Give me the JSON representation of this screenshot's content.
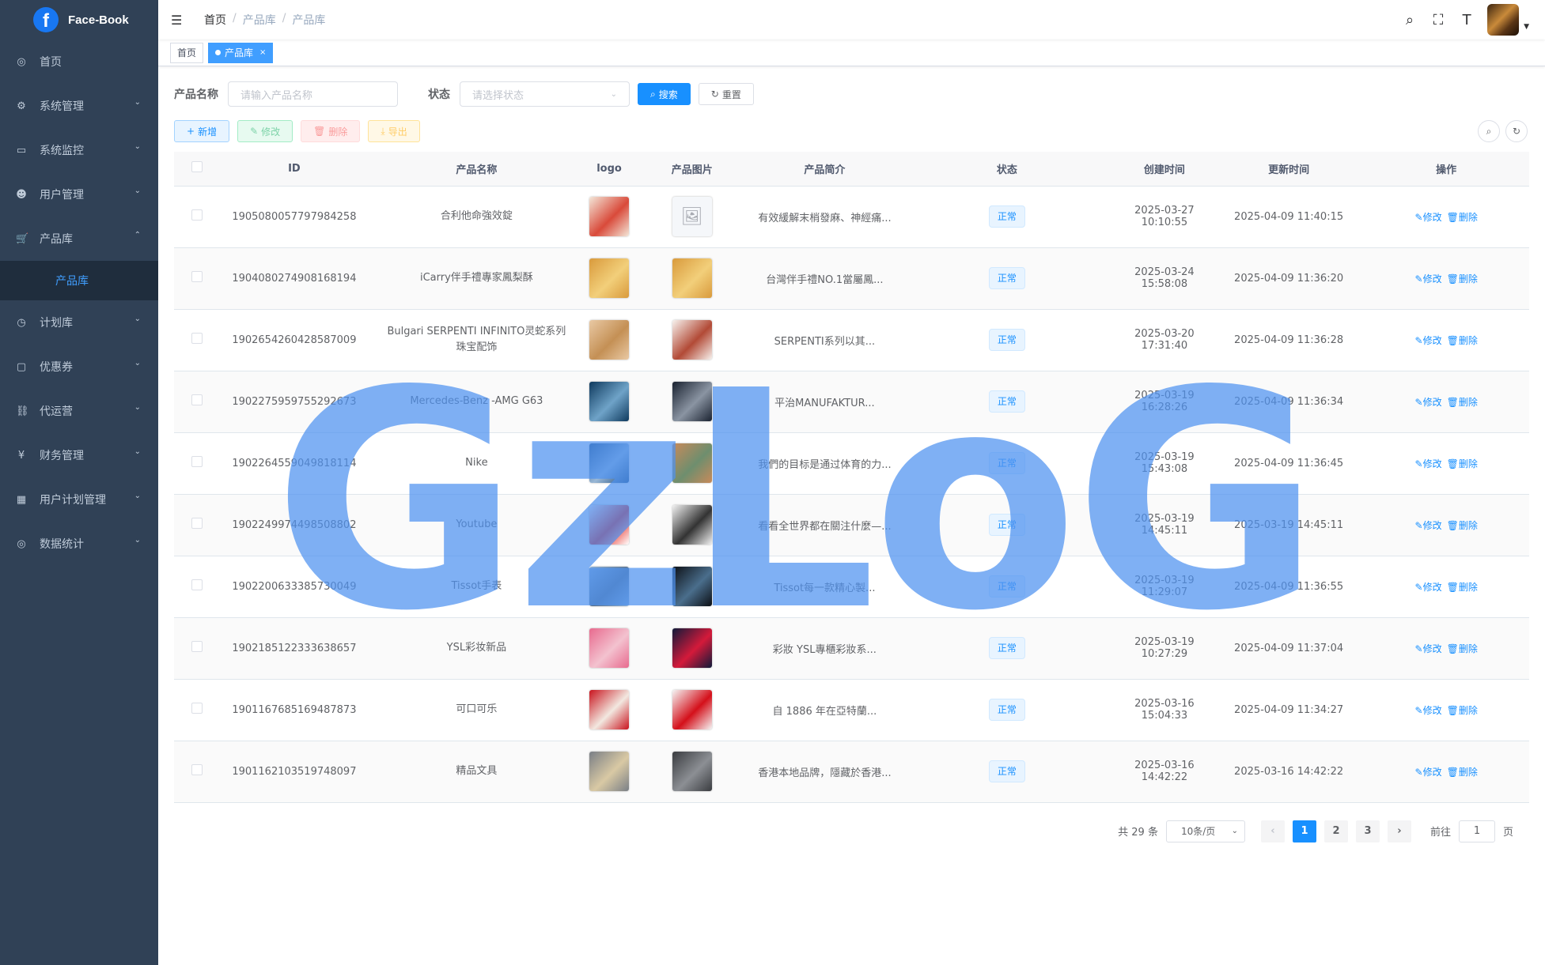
{
  "app": {
    "title": "Face-Book",
    "logo_letter": "f"
  },
  "sidebar": {
    "items": [
      {
        "label": "首页",
        "icon": "dashboard-icon",
        "glyph": "◎",
        "arrow": ""
      },
      {
        "label": "系统管理",
        "icon": "gear-icon",
        "glyph": "⚙",
        "arrow": "⌄"
      },
      {
        "label": "系统监控",
        "icon": "monitor-icon",
        "glyph": "▭",
        "arrow": "⌄"
      },
      {
        "label": "用户管理",
        "icon": "user-icon",
        "glyph": "☻",
        "arrow": "⌄"
      },
      {
        "label": "产品库",
        "icon": "cart-icon",
        "glyph": "🛒",
        "arrow": "⌃"
      },
      {
        "label": "计划库",
        "icon": "clock-icon",
        "glyph": "◷",
        "arrow": "⌄"
      },
      {
        "label": "优惠券",
        "icon": "coupon-icon",
        "glyph": "▢",
        "arrow": "⌄"
      },
      {
        "label": "代运营",
        "icon": "agent-icon",
        "glyph": "⛓",
        "arrow": "⌄"
      },
      {
        "label": "财务管理",
        "icon": "yen-icon",
        "glyph": "¥",
        "arrow": "⌄"
      },
      {
        "label": "用户计划管理",
        "icon": "grid-icon",
        "glyph": "▦",
        "arrow": "⌄"
      },
      {
        "label": "数据统计",
        "icon": "chart-icon",
        "glyph": "◎",
        "arrow": "⌄"
      }
    ],
    "active_sub": "产品库"
  },
  "header": {
    "breadcrumb": [
      "首页",
      "产品库",
      "产品库"
    ],
    "separator": "/"
  },
  "tags": {
    "home": "首页",
    "active": "产品库",
    "close": "×"
  },
  "search": {
    "name_label": "产品名称",
    "name_placeholder": "请输入产品名称",
    "status_label": "状态",
    "status_placeholder": "请选择状态",
    "search_button": "搜索",
    "reset_button": "重置"
  },
  "toolbar": {
    "add": "新增",
    "edit": "修改",
    "delete": "删除",
    "export": "导出"
  },
  "table": {
    "columns": [
      "ID",
      "产品名称",
      "logo",
      "产品图片",
      "产品简介",
      "状态",
      "创建时间",
      "更新时间",
      "操作"
    ],
    "edit_label": "修改",
    "delete_label": "删除",
    "rows": [
      {
        "id": "1905080057797984258",
        "name": "合利他命強效錠",
        "logo": "#f3e6d8,#d94a3a",
        "image": "empty",
        "intro": "有效緩解末梢發麻、神經痛...",
        "status": "正常",
        "created": "2025-03-27 10:10:55",
        "updated": "2025-04-09 11:40:15"
      },
      {
        "id": "1904080274908168194",
        "name": "iCarry伴手禮專家鳳梨酥",
        "logo": "#d99a3c,#f2cf7a",
        "image": "#d99a3c,#f2cf7a",
        "intro": "台灣伴手禮NO.1當屬鳳...",
        "status": "正常",
        "created": "2025-03-24 15:58:08",
        "updated": "2025-04-09 11:36:20"
      },
      {
        "id": "1902654260428587009",
        "name": "Bulgari SERPENTI INFINITO灵蛇系列珠宝配饰",
        "logo": "#e9c9a4,#c49055",
        "image": "#f7f2ee,#b24a36",
        "intro": "SERPENTI系列以其...",
        "status": "正常",
        "created": "2025-03-20 17:31:40",
        "updated": "2025-04-09 11:36:28"
      },
      {
        "id": "1902275959755292673",
        "name": "Mercedes-Benz -AMG G63",
        "logo": "#0f3a5e,#6fa3c8",
        "image": "#1a2230,#8a94a2",
        "intro": "平治MANUFAKTUR...",
        "status": "正常",
        "created": "2025-03-19 16:28:26",
        "updated": "2025-04-09 11:36:34"
      },
      {
        "id": "1902264559049818114",
        "name": "Nike",
        "logo": "#1f4a7a,#9ab8d6",
        "image": "#c88a5a,#6e8e6e",
        "intro": "我們的目标是通过体育的力...",
        "status": "正常",
        "created": "2025-03-19 15:43:08",
        "updated": "2025-04-09 11:36:45"
      },
      {
        "id": "1902249974498508802",
        "name": "Youtube",
        "logo": "#ffffff,#e62117",
        "image": "#f2f2f2,#333333",
        "intro": "看看全世界都在關注什麼—...",
        "status": "正常",
        "created": "2025-03-19 14:45:11",
        "updated": "2025-03-19 14:45:11"
      },
      {
        "id": "1902200633385730049",
        "name": "Tissot手表",
        "logo": "#8fb3d9,#5a6f86",
        "image": "#0c0f14,#4a6e8c",
        "intro": "Tissot每一款精心製...",
        "status": "正常",
        "created": "2025-03-19 11:29:07",
        "updated": "2025-04-09 11:36:55"
      },
      {
        "id": "1902185122333638657",
        "name": "YSL彩妆新品",
        "logo": "#e86a8e,#f3c2cf",
        "image": "#101a3a,#d41a3a",
        "intro": "彩妝 YSL專櫃彩妝系...",
        "status": "正常",
        "created": "2025-03-19 10:27:29",
        "updated": "2025-04-09 11:37:04"
      },
      {
        "id": "1901167685169487873",
        "name": "可口可乐",
        "logo": "#c9141e,#f2e8e0",
        "image": "#f5f5f5,#d4101a",
        "intro": "自 1886 年在亞特蘭...",
        "status": "正常",
        "created": "2025-03-16 15:04:33",
        "updated": "2025-04-09 11:34:27"
      },
      {
        "id": "1901162103519748097",
        "name": "精品文具",
        "logo": "#7a7f86,#d9c9a4",
        "image": "#3a3c40,#8c8f94",
        "intro": "香港本地品牌，隱藏於香港...",
        "status": "正常",
        "created": "2025-03-16 14:42:22",
        "updated": "2025-03-16 14:42:22"
      }
    ]
  },
  "pagination": {
    "total": "共 29 条",
    "page_size": "10条/页",
    "pages": [
      "1",
      "2",
      "3"
    ],
    "current": "1",
    "goto_label": "前往",
    "goto_value": "1",
    "page_suffix": "页"
  },
  "watermark": "GzLoG",
  "colors": {
    "sidebar": "#304156",
    "primary": "#1890ff",
    "watermark": "#4d91f0"
  }
}
